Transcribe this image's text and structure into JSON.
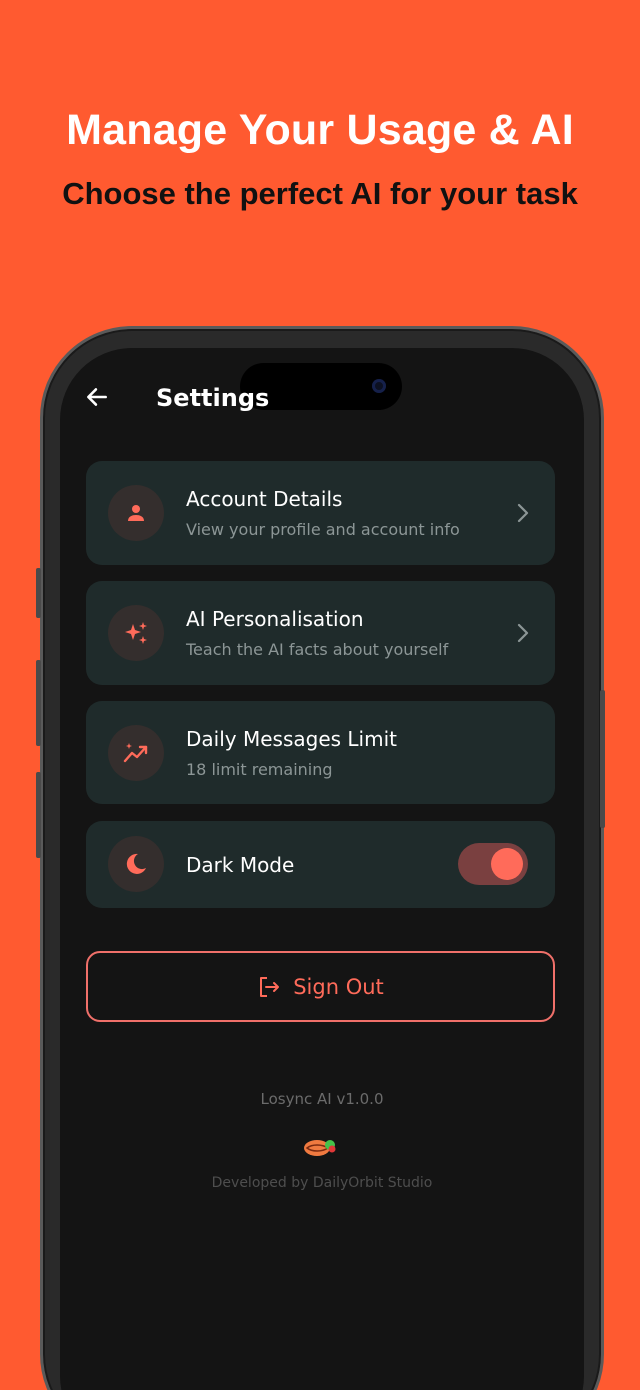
{
  "hero": {
    "title": "Manage Your Usage & AI",
    "subtitle": "Choose the perfect AI for your task"
  },
  "header": {
    "title": "Settings",
    "back_icon": "arrow-left-icon"
  },
  "settings": [
    {
      "title": "Account Details",
      "subtitle": "View your profile and account info",
      "icon": "person-icon",
      "chevron": true
    },
    {
      "title": "AI Personalisation",
      "subtitle": "Teach the AI facts about yourself",
      "icon": "sparkles-icon",
      "chevron": true
    },
    {
      "title": "Daily Messages Limit",
      "subtitle": "18 limit remaining",
      "icon": "trending-icon",
      "chevron": false
    },
    {
      "title": "Dark Mode",
      "icon": "moon-icon",
      "toggle_on": true
    }
  ],
  "sign_out": {
    "label": "Sign Out",
    "icon": "logout-icon"
  },
  "footer": {
    "version": "Losync AI v1.0.0",
    "developer": "Developed by DailyOrbit Studio",
    "logo": "studio-logo"
  },
  "colors": {
    "background": "#FF5A30",
    "accent": "#FF6B5A",
    "card": "#1f2b2b",
    "screen": "#141414"
  }
}
